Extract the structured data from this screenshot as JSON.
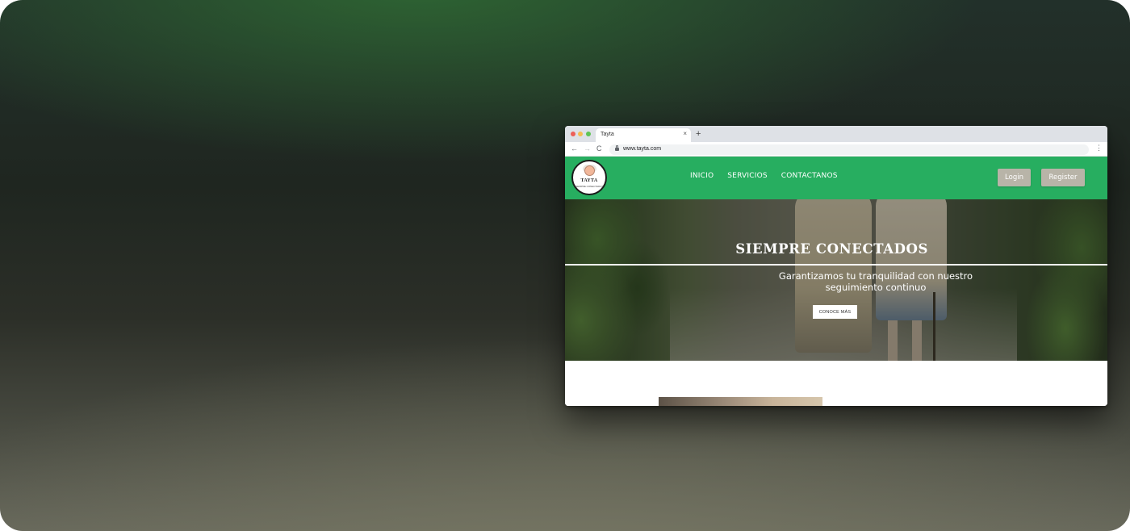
{
  "browser": {
    "tab_title": "Tayta",
    "tab_close": "×",
    "new_tab": "+",
    "url": "www.tayta.com",
    "nav": {
      "back": "←",
      "forward": "→",
      "reload": "C"
    },
    "menu": "⋮"
  },
  "site": {
    "logo": {
      "name": "TAYTA",
      "tagline": "SIEMPRE CONECTADOS"
    },
    "nav_items": [
      "INICIO",
      "SERVICIOS",
      "CONTACTANOS"
    ],
    "login_label": "Login",
    "register_label": "Register",
    "hero": {
      "title": "SIEMPRE CONECTADOS",
      "subtitle": "Garantizamos tu tranquilidad con nuestro seguimiento continuo",
      "cta_label": "CONOCE MÁS"
    },
    "colors": {
      "header": "#27ae60",
      "auth_button": "#b8b4a8"
    }
  }
}
